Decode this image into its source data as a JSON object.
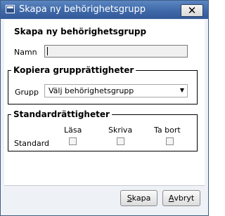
{
  "window": {
    "title": "Skapa ny behörighetsgrupp",
    "close_glyph": "✕"
  },
  "form": {
    "heading": "Skapa ny behörighetsgrupp",
    "name_label": "Namn",
    "name_value": ""
  },
  "copy_section": {
    "legend": "Kopiera grupprättigheter",
    "group_label": "Grupp",
    "group_selected": "Välj behörighetsgrupp",
    "arrow": "▼"
  },
  "standard_section": {
    "legend": "Standardrättigheter",
    "columns": [
      "Läsa",
      "Skriva",
      "Ta bort"
    ],
    "row_label": "Standard",
    "checked": [
      false,
      false,
      false
    ]
  },
  "buttons": {
    "create_first": "S",
    "create_rest": "kapa",
    "cancel_first": "A",
    "cancel_rest": "vbryt"
  },
  "icons": {
    "app": "window-icon",
    "close": "close-icon",
    "dropdown": "chevron-down-icon"
  }
}
